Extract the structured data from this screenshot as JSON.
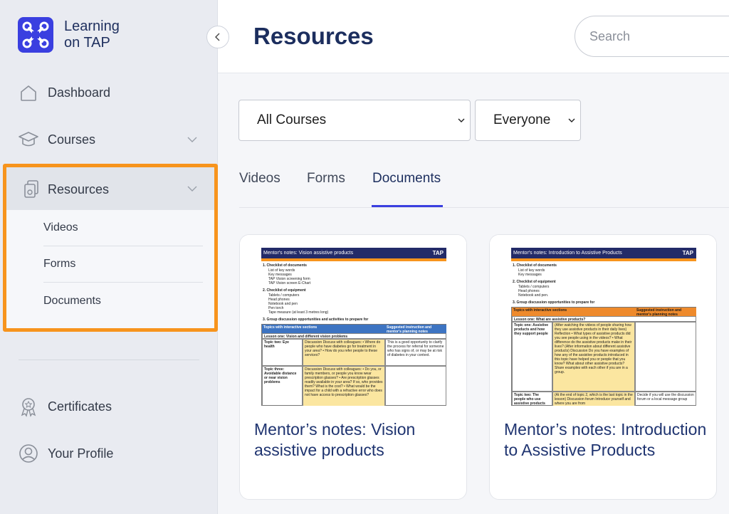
{
  "sidebar": {
    "brand": "Learning on TAP",
    "nav": {
      "dashboard": "Dashboard",
      "courses": "Courses",
      "resources": "Resources",
      "certificates": "Certificates",
      "profile": "Your Profile"
    },
    "resources_sub": [
      "Videos",
      "Forms",
      "Documents"
    ]
  },
  "header": {
    "title": "Resources",
    "search_placeholder": "Search"
  },
  "filters": {
    "course": "All Courses",
    "audience": "Everyone"
  },
  "tabs": [
    "Videos",
    "Forms",
    "Documents"
  ],
  "active_tab": "Documents",
  "cards": [
    {
      "title": "Mentor’s notes: Vision assistive products",
      "doc": {
        "header": "Mentor's notes: Vision assistive products",
        "brand": "TAP",
        "s1": "1. Checklist of documents",
        "s1_items": [
          "List of key words",
          "Key messages",
          "TAP Vision screening form",
          "TAP Vision screen E-Chart"
        ],
        "s2": "2. Checklist of equipment",
        "s2_items": [
          "Tablets / computers",
          "Head phones",
          "Notebook and pen",
          "Pen torch",
          "Tape measure (at least 3 metres long)"
        ],
        "s3": "3. Group discussion opportunities and activities to prepare for",
        "col1": "Topics with interactive sections",
        "col2": "Suggested instruction and mentor's planning notes",
        "lesson": "Lesson one: Vision and different vision problems",
        "r1_topic": "Topic two: Eye health",
        "r1_body": "Discussion  Discuss with colleagues: • Where do people who have diabetes go for treatment in your area? • How do you refer people to these services?",
        "r1_note": "This is a good opportunity to clarify the process for referral for someone who has signs of, or may be at risk of diabetes in your context.",
        "r2_topic": "Topic three: Avoidable distance or near vision problems",
        "r2_body": "Discussion  Discuss with colleagues: • Do you, or family members, or people you know wear prescription glasses? • Are prescription glasses readily available in your area? If so, who provides them? What is the cost? • What would be the impact for a child with a refractive error who does not have access to prescription glasses?"
      }
    },
    {
      "title": "Mentor’s notes: Introduction to Assistive Products",
      "doc": {
        "header": "Mentor's notes: Introduction to Assistive Products",
        "brand": "TAP",
        "s1": "1. Checklist of documents",
        "s1_items": [
          "List of key words",
          "Key messages"
        ],
        "s2": "2. Checklist of equipment",
        "s2_items": [
          "Tablets / computers",
          "Head phones",
          "Notebook and pen."
        ],
        "s3": "3. Group discussion opportunities to prepare for",
        "col1": "Topics with interactive sections",
        "col2": "Suggested instruction and mentor's planning notes",
        "lesson": "Lesson one: What are assistive products?",
        "r1_topic": "Topic one: Assistive products and how they support people",
        "r1_body": "(After watching the videos of people sharing how they use assistive products in their daily lives)  Reflection • What types of assistive products did you see people using in the videos? • What difference do the assistive products make in their lives?  (After information about different assistive products)  Discussion  Do you have examples of how any of the assistive products introduced in this topic have helped you or people that you know? What about other assistive products? Share examples with each other if you are in a group.",
        "r1_note": "",
        "r2_topic": "Topic two: The people who use assistive products",
        "r2_body": "(At the end of topic 2, which is the last topic in the lesson)  Discussion forum  Introduce yourself and where you are from",
        "r2_note": "Decide if you will use the discussion forum or a local message group"
      }
    }
  ]
}
